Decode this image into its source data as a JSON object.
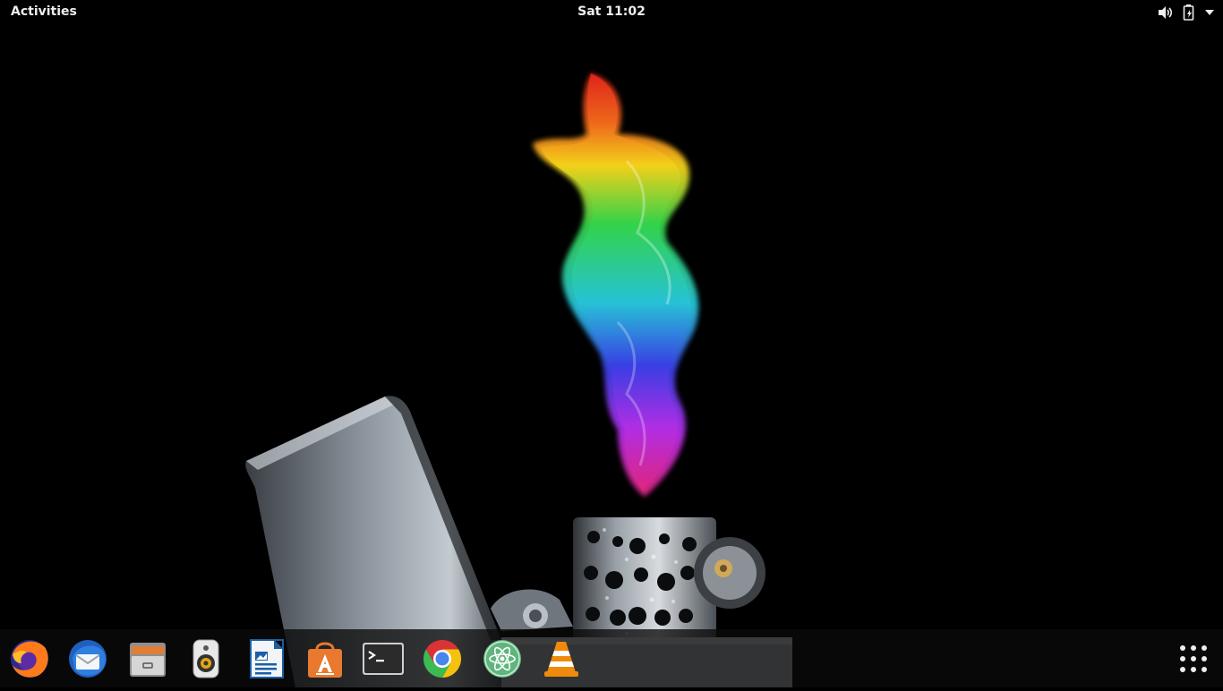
{
  "topbar": {
    "activities_label": "Activities",
    "clock": "Sat 11:02",
    "status_icons": [
      "speaker-icon",
      "battery-charging-icon",
      "system-menu-arrow-icon"
    ]
  },
  "wallpaper": {
    "subject": "lighter-rainbow-flame",
    "flame_colors": [
      "#e0241c",
      "#f7a21a",
      "#f5e21a",
      "#33d44a",
      "#27c3d8",
      "#3a3fe6",
      "#b32ee6",
      "#e0267e"
    ]
  },
  "dock": {
    "apps": [
      {
        "icon": "firefox-icon"
      },
      {
        "icon": "thunderbird-icon"
      },
      {
        "icon": "files-icon"
      },
      {
        "icon": "rhythmbox-icon"
      },
      {
        "icon": "libreoffice-writer-icon"
      },
      {
        "icon": "software-center-icon"
      },
      {
        "icon": "terminal-icon"
      },
      {
        "icon": "chrome-icon"
      },
      {
        "icon": "atom-editor-icon"
      },
      {
        "icon": "vlc-icon"
      }
    ],
    "app_grid_icon": "show-applications-icon"
  }
}
